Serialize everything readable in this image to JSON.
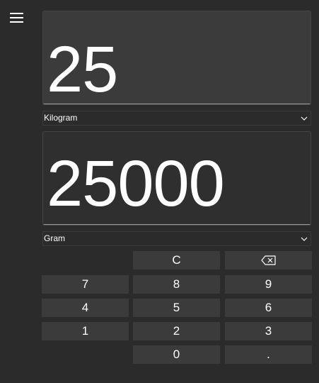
{
  "menu": {
    "icon": "hamburger-menu-icon"
  },
  "converter": {
    "input_value": "25",
    "input_unit": "Kilogram",
    "output_value": "25000",
    "output_unit": "Gram"
  },
  "keypad": {
    "clear": "C",
    "backspace_icon": "backspace-icon",
    "seven": "7",
    "eight": "8",
    "nine": "9",
    "four": "4",
    "five": "5",
    "six": "6",
    "one": "1",
    "two": "2",
    "three": "3",
    "zero": "0",
    "decimal": "."
  },
  "colors": {
    "background": "#2b2b2b",
    "input_box": "#3b3b3b",
    "output_box": "#2f2f2f",
    "key": "#3b3b3b",
    "text": "#ffffff"
  }
}
